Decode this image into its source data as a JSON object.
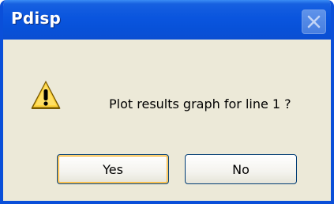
{
  "window": {
    "title": "Pdisp",
    "close_icon": "close-icon"
  },
  "dialog": {
    "icon": "warning-icon",
    "message": "Plot results graph for line 1 ?",
    "buttons": {
      "yes_label": "Yes",
      "no_label": "No",
      "default": "yes"
    }
  },
  "colors": {
    "titlebar": "#0a55de",
    "frame": "#0a4fd9",
    "body": "#ece9d8",
    "warning_fill": "#ffd43b",
    "default_button_focus": "#f6b43b"
  }
}
